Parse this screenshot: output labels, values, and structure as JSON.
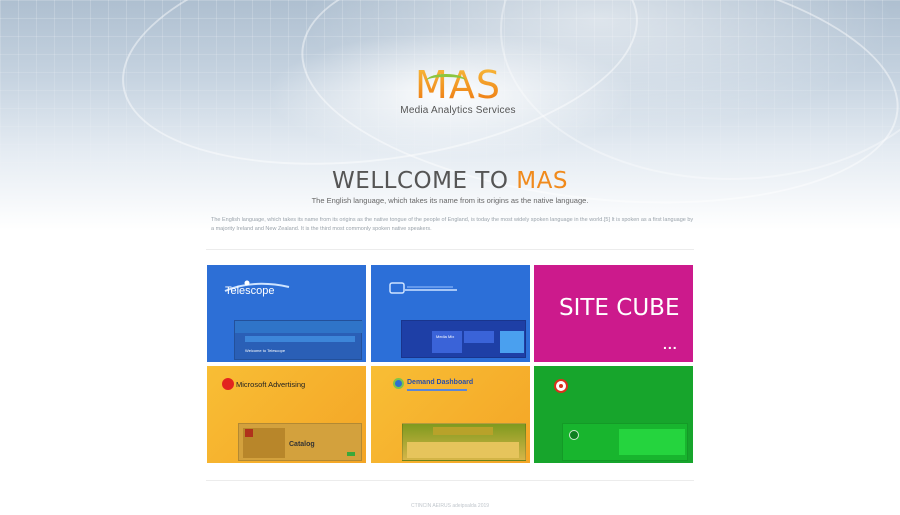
{
  "logo": {
    "name": "MAS",
    "subtitle": "Media Analytics Services"
  },
  "hero": {
    "title_prefix": "WELLCOME TO ",
    "title_accent": "MAS",
    "tagline": "The English language, which takes its name from its origins as the native language.",
    "intro": "The English language, which takes its name from its origins as the native tongue of the people of England, is today the most widely spoken language in the world.[5] It is spoken as a first language by a majority Ireland and New Zealand. It is the third most commonly spoken native speakers."
  },
  "tiles": [
    {
      "id": "telescope",
      "label": "Telescope",
      "caption": "Welcome to Telescope",
      "color": "#2d6fd6",
      "icon": "telescope-logo"
    },
    {
      "id": "monitor",
      "label": "MONITORING",
      "color": "#2c6fd8",
      "icon": "monitor-logo",
      "panel_labels": [
        "Media Mix",
        "",
        ""
      ]
    },
    {
      "id": "site-cube",
      "label": "SITE CUBE",
      "more": "...",
      "color": "#cc1a8c"
    },
    {
      "id": "microsoft-advertising",
      "label": "Microsoft Advertising",
      "caption": "Catalog",
      "color": "#f6b32a",
      "icon": "microsoft-advertising-logo"
    },
    {
      "id": "demand-dashboard",
      "label": "Demand Dashboard",
      "color": "#f6b32a",
      "icon": "dashboard-logo"
    },
    {
      "id": "green-app",
      "label": "",
      "color": "#17a52c",
      "icon": "circle-logo"
    }
  ],
  "footer": {
    "text": "CTINCIN AEIRUS adeipsalda 2019"
  },
  "colors": {
    "accent": "#f08a1c",
    "blue": "#2d6fd6",
    "magenta": "#cc1a8c",
    "orange": "#f6b32a",
    "green": "#17a52c"
  }
}
